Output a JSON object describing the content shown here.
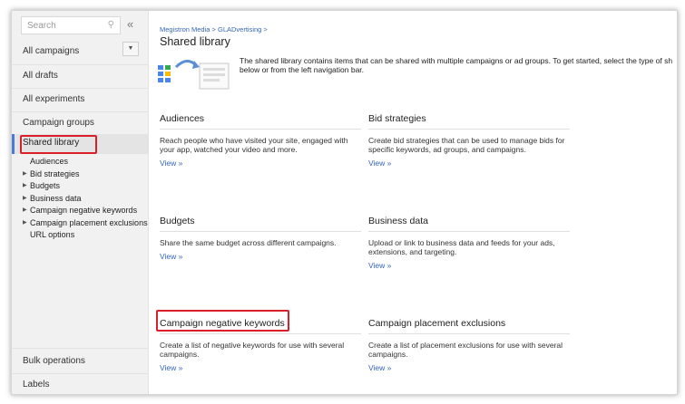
{
  "sidebar": {
    "search_placeholder": "Search",
    "collapse_glyph": "«",
    "items": {
      "all_campaigns": "All campaigns",
      "all_drafts": "All drafts",
      "all_experiments": "All experiments",
      "campaign_groups": "Campaign groups",
      "shared_library": "Shared library",
      "bulk_operations": "Bulk operations",
      "labels": "Labels"
    },
    "sub_items": [
      {
        "label": "Audiences",
        "expandable": false
      },
      {
        "label": "Bid strategies",
        "expandable": true
      },
      {
        "label": "Budgets",
        "expandable": true
      },
      {
        "label": "Business data",
        "expandable": true
      },
      {
        "label": "Campaign negative keywords",
        "expandable": true
      },
      {
        "label": "Campaign placement exclusions",
        "expandable": true
      },
      {
        "label": "URL options",
        "expandable": false
      }
    ]
  },
  "main": {
    "breadcrumb": "Megistron Media > GLADvertising >",
    "title": "Shared library",
    "intro": "The shared library contains items that can be shared with multiple campaigns or ad groups. To get started, select the type of sh below or from the left navigation bar.",
    "view_label": "View »",
    "cards": {
      "audiences": {
        "title": "Audiences",
        "desc": "Reach people who have visited your site, engaged with your app, watched your video and more."
      },
      "bid_strategies": {
        "title": "Bid strategies",
        "desc": "Create bid strategies that can be used to manage bids for specific keywords, ad groups, and campaigns."
      },
      "budgets": {
        "title": "Budgets",
        "desc": "Share the same budget across different campaigns."
      },
      "business_data": {
        "title": "Business data",
        "desc": "Upload or link to business data and feeds for your ads, extensions, and targeting."
      },
      "campaign_negative_keywords": {
        "title": "Campaign negative keywords",
        "desc": "Create a list of negative keywords for use with several campaigns."
      },
      "campaign_placement_exclusions": {
        "title": "Campaign placement exclusions",
        "desc": "Create a list of placement exclusions for use with several campaigns."
      }
    }
  },
  "colors": {
    "highlight_red": "#d9202a",
    "link_blue": "#3366bb",
    "selected_bar": "#4a7ad2"
  }
}
